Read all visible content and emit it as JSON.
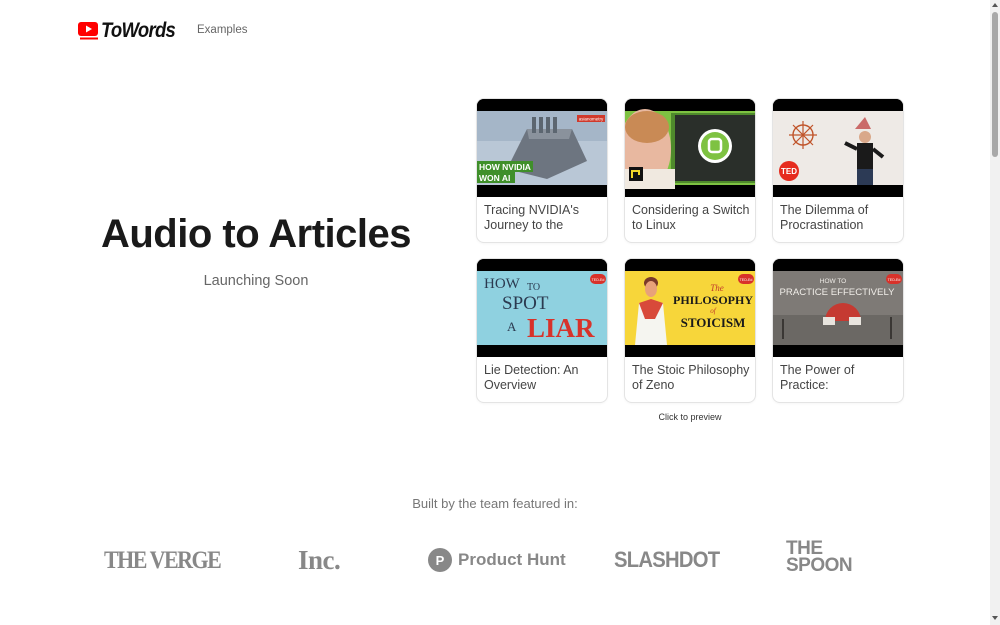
{
  "header": {
    "logo_text": "ToWords",
    "nav_examples": "Examples"
  },
  "hero": {
    "title": "Audio to Articles",
    "subtitle": "Launching Soon"
  },
  "cards": [
    {
      "title": "Tracing NVIDIA's Journey to the",
      "thumb_caption": "HOW NVIDIA WON AI",
      "badge": "asianometry"
    },
    {
      "title": "Considering a Switch to Linux",
      "thumb_caption": "",
      "badge": ""
    },
    {
      "title": "The Dilemma of Procrastination",
      "thumb_caption": "",
      "badge": "TED"
    },
    {
      "title": "Lie Detection: An Overview",
      "thumb_caption": "HOW TO SPOT A LIAR",
      "badge": "TED-Ed"
    },
    {
      "title": "The Stoic Philosophy of Zeno",
      "thumb_caption": "The PHILOSOPHY of STOICISM",
      "badge": "TED-Ed"
    },
    {
      "title": "The Power of Practice:",
      "thumb_caption": "HOW TO PRACTICE EFFECTIVELY",
      "badge": "TED-Ed"
    }
  ],
  "click_hint": "Click to preview",
  "featured": {
    "label": "Built by the team featured in:",
    "press": [
      "THE VERGE",
      "Inc.",
      "Product Hunt",
      "SLASHDOT",
      "THE SPOON"
    ],
    "ph_letter": "P",
    "spoon_lines": [
      "THE",
      "SPOON"
    ]
  },
  "thumb_texts": {
    "nvidia_line1": "HOW NVIDIA",
    "nvidia_line2": "WON AI",
    "ted": "TED",
    "liar_how": "HOW",
    "liar_to": "TO",
    "liar_spot": "SPOT",
    "liar_a": "A",
    "liar_liar": "LIAR",
    "stoic_the": "The",
    "stoic_philosophy": "PHILOSOPHY",
    "stoic_of": "of",
    "stoic_stoicism": "STOICISM",
    "practice_how": "HOW TO",
    "practice_line": "PRACTICE EFFECTIVELY",
    "teded": "TED-Ed"
  },
  "colors": {
    "logo_red": "#ff0000",
    "nvidia_green": "#5aa12a",
    "linux_green": "#7ec242",
    "ted_red": "#e62b1e",
    "liar_bg": "#8fd1e0",
    "liar_red": "#d8322a",
    "stoic_yellow": "#f7d63a",
    "press_gray": "#888888"
  }
}
